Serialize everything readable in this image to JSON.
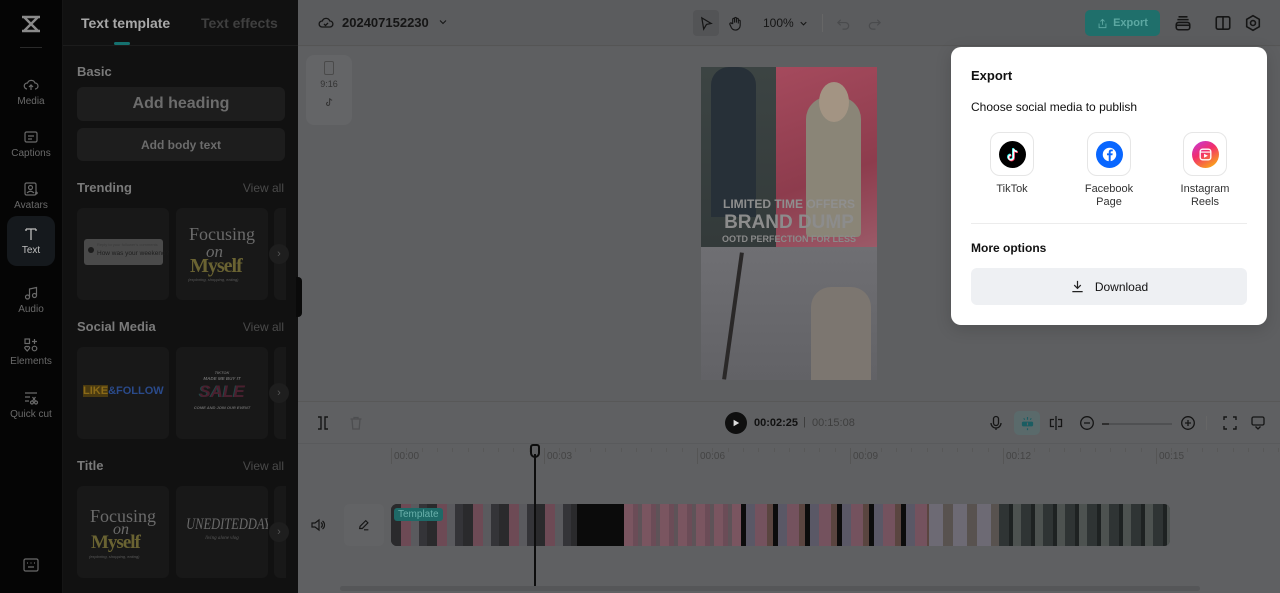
{
  "rail": {
    "items": [
      {
        "label": "Media",
        "icon": "cloud-upload-icon"
      },
      {
        "label": "Captions",
        "icon": "captions-icon"
      },
      {
        "label": "Avatars",
        "icon": "avatar-icon"
      },
      {
        "label": "Text",
        "icon": "text-icon",
        "active": true
      },
      {
        "label": "Audio",
        "icon": "music-note-icon"
      },
      {
        "label": "Elements",
        "icon": "elements-icon"
      },
      {
        "label": "Quick cut",
        "icon": "quick-cut-icon"
      }
    ]
  },
  "panel": {
    "tabs": [
      {
        "label": "Text template",
        "active": true
      },
      {
        "label": "Text effects",
        "active": false
      }
    ],
    "basic": {
      "title": "Basic",
      "add_heading": "Add heading",
      "add_body": "Add body text"
    },
    "trending": {
      "title": "Trending",
      "view_all": "View all",
      "cards": [
        {
          "subtitle": "Reply to your follower's comments",
          "text": "How was your weekend?"
        },
        {
          "line1": "Focusing",
          "line2": "on",
          "line3": "Myself",
          "line4": "(exploring, shopping, eating)"
        }
      ]
    },
    "social_media": {
      "title": "Social Media",
      "view_all": "View all",
      "cards": [
        {
          "text_a": "LIKE",
          "text_b": "&FOLLOW"
        },
        {
          "top1": "TIKTOK",
          "top2": "MADE ME BUY IT",
          "main": "SALE",
          "bottom": "COME AND JOIN OUR EVENT"
        }
      ]
    },
    "title_section": {
      "title": "Title",
      "view_all": "View all",
      "cards": [
        {
          "line1": "Focusing",
          "line2": "on",
          "line3": "Myself",
          "line4": "(exploring, shopping, eating)"
        },
        {
          "main": "UNEDITEDDAY",
          "sub": "living alone vlog"
        }
      ]
    }
  },
  "topbar": {
    "project_name": "202407152230",
    "zoom": "100%",
    "export_label": "Export"
  },
  "canvas": {
    "ratio": "9:16",
    "preview_text": {
      "line1": "LIMITED TIME OFFERS",
      "line2": "BRAND DUMP",
      "line3": "OOTD PERFECTION FOR LESS"
    }
  },
  "export_popover": {
    "title": "Export",
    "subtitle": "Choose social media to publish",
    "platforms": [
      {
        "label": "TikTok",
        "color": "#000000"
      },
      {
        "label": "Facebook Page",
        "color": "#0866ff"
      },
      {
        "label": "Instagram Reels",
        "color": "#e1306c"
      }
    ],
    "more_options": "More options",
    "download_label": "Download"
  },
  "timeline": {
    "current_time": "00:02:25",
    "separator": "|",
    "total_time": "00:15:08",
    "ruler": [
      "00:00",
      "00:03",
      "00:06",
      "00:09",
      "00:12",
      "00:15"
    ],
    "track_tag": "Template",
    "zoom_level": 0.1
  }
}
